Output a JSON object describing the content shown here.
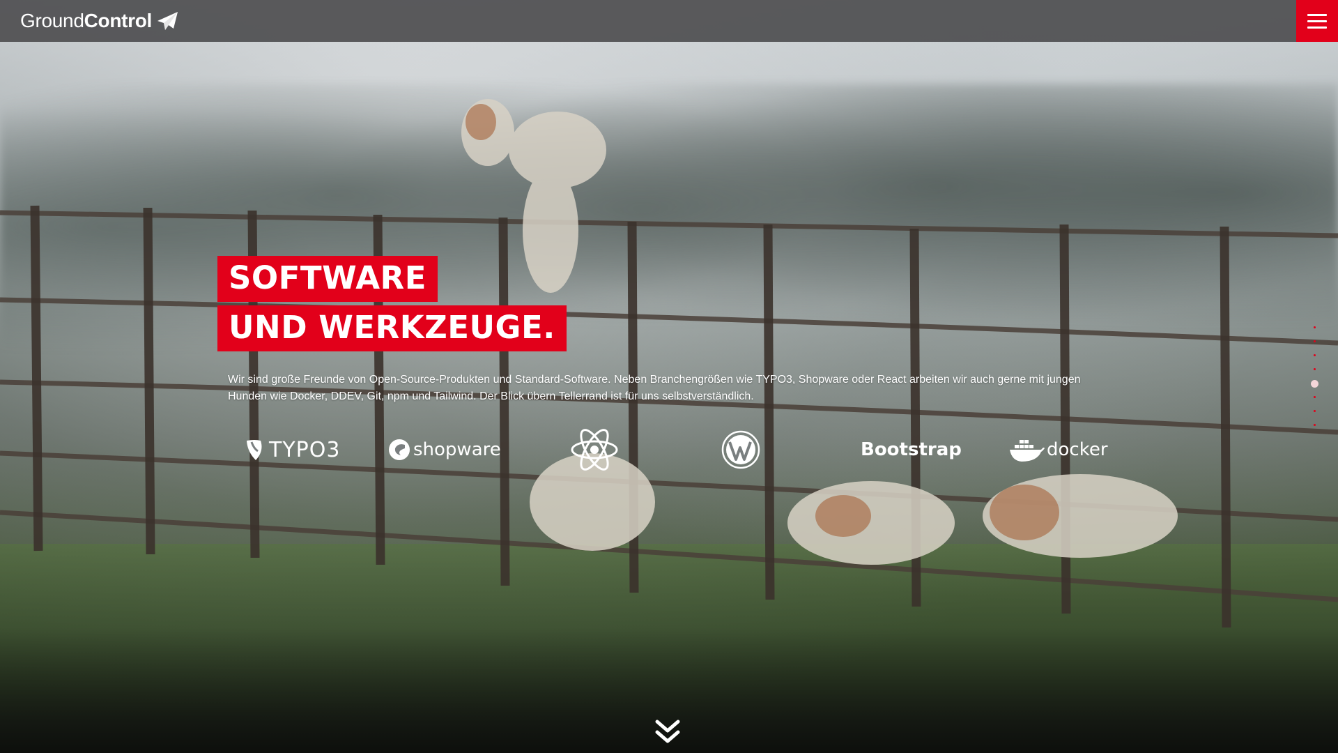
{
  "header": {
    "logo_light": "Ground",
    "logo_bold": "Control",
    "logo_icon": "paper-plane-icon",
    "menu_icon": "hamburger-icon",
    "accent_color": "#e2001a"
  },
  "hero": {
    "headline_line1": "SOFTWARE",
    "headline_line2": "UND WERKZEUGE.",
    "intro": "Wir sind große Freunde von Open-Source-Produkten und Standard-Software. Neben Branchengrößen wie TYPO3, Shopware oder React arbeiten wir auch gerne mit jungen Hunden wie Docker, DDEV, Git, npm und Tailwind. Der Blick übern Tellerrand ist für uns selbstverständlich."
  },
  "tech_logos": {
    "typo3": "TYPO3",
    "shopware": "shopware",
    "react_icon": "react-atom-icon",
    "wordpress_icon": "wordpress-icon",
    "bootstrap": "Bootstrap",
    "docker": "docker"
  },
  "side_nav": {
    "dot_count": 8,
    "active_index": 4
  },
  "scroll_down_icon": "double-chevron-down-icon"
}
